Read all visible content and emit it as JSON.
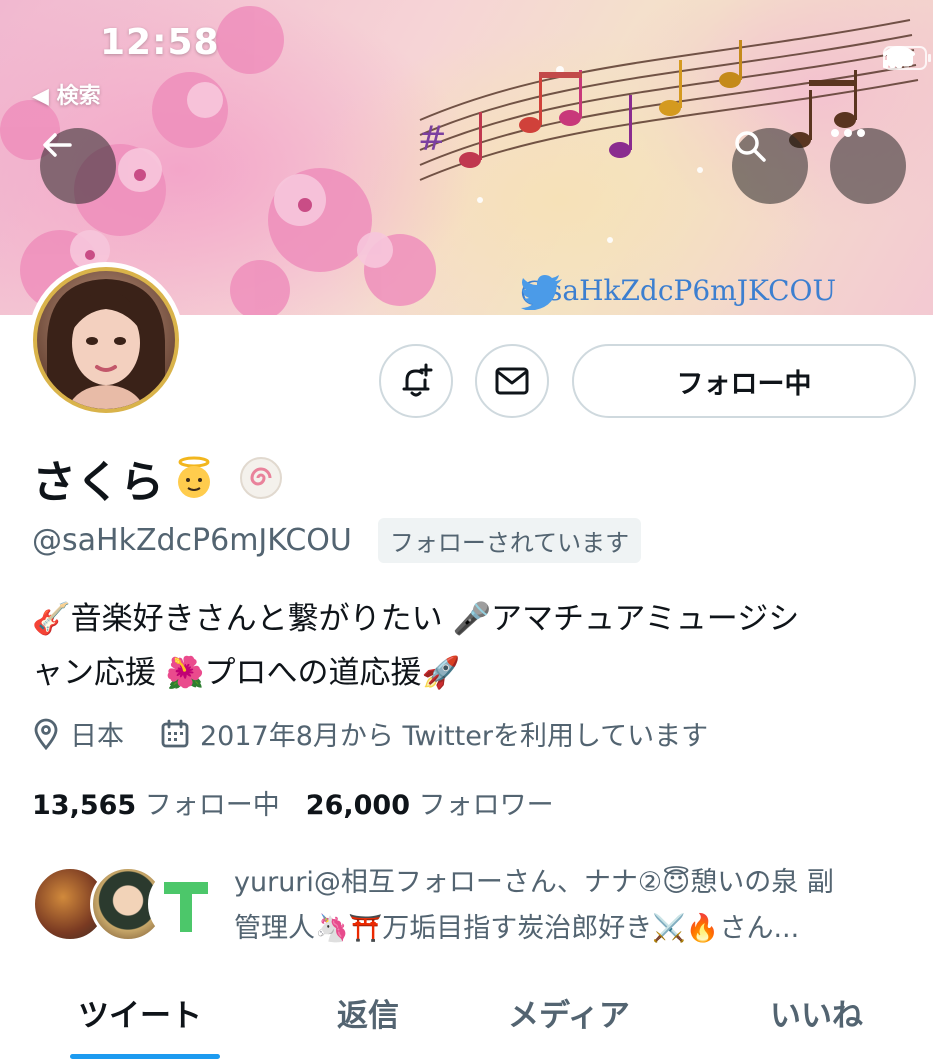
{
  "status_bar": {
    "time": "12:58",
    "back_label": "◀ 検索"
  },
  "banner": {
    "watermark": "@saHkZdcP6mJKCOU"
  },
  "profile": {
    "name": "さくら",
    "handle": "@saHkZdcP6mJKCOU",
    "follows_you_badge": "フォローされています",
    "bio_line1": "🎸音楽好きさんと繋がりたい 🎤アマチュアミュージシ",
    "bio_line2": "ャン応援 🌺プロへの道応援🚀",
    "location": "日本",
    "joined": "2017年8月から Twitterを利用しています",
    "following_count": "13,565",
    "following_label": "フォロー中",
    "followers_count": "26,000",
    "followers_label": "フォロワー",
    "followed_by_line1": "yururi@相互フォローさん、ナナ②😇憩いの泉 副",
    "followed_by_line2": "管理人🦄⛩️万垢目指す炭治郎好き⚔️🔥さん..."
  },
  "actions": {
    "follow_button": "フォロー中"
  },
  "tabs": [
    {
      "label": "ツイート",
      "active": true
    },
    {
      "label": "返信",
      "active": false
    },
    {
      "label": "メディア",
      "active": false
    },
    {
      "label": "いいね",
      "active": false
    }
  ],
  "colors": {
    "accent": "#1d9bf0",
    "avatar_ring": "#d9b34a",
    "secondary_text": "#536471"
  },
  "icons": [
    "back-arrow-icon",
    "search-icon",
    "more-icon",
    "notify-bell-icon",
    "mail-icon",
    "location-icon",
    "calendar-icon",
    "twitter-bird-icon"
  ]
}
